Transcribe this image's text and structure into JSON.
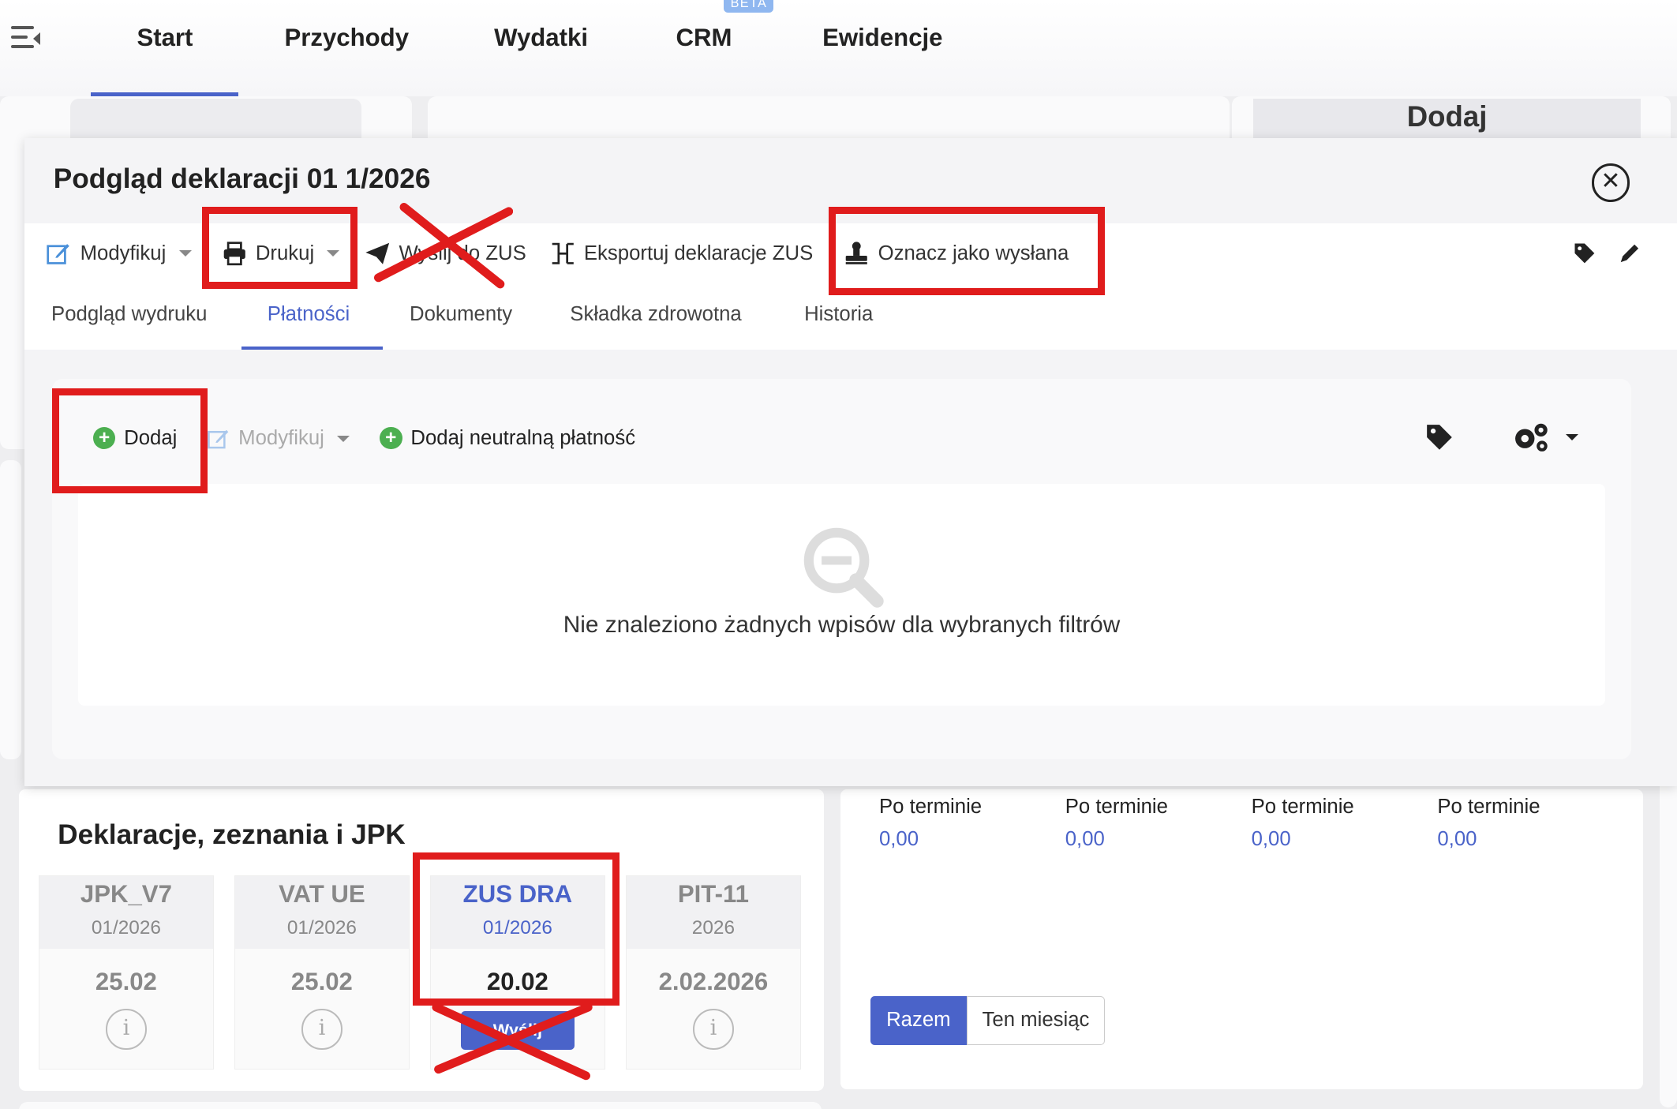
{
  "nav": {
    "items": [
      "Start",
      "Przychody",
      "Wydatki",
      "CRM",
      "Ewidencje"
    ],
    "beta_badge": "BETA"
  },
  "background": {
    "add_button": "Dodaj"
  },
  "modal": {
    "title": "Podgląd deklaracji 01 1/2026",
    "toolbar": {
      "modify": "Modyfikuj",
      "print": "Drukuj",
      "send_zus": "Wyślij do ZUS",
      "export": "Eksportuj deklaracje ZUS",
      "mark_sent": "Oznacz jako wysłana"
    },
    "tabs": [
      "Podgląd wydruku",
      "Płatności",
      "Dokumenty",
      "Składka zdrowotna",
      "Historia"
    ],
    "active_tab": "Płatności",
    "payments": {
      "add": "Dodaj",
      "modify": "Modyfikuj",
      "add_neutral": "Dodaj neutralną płatność",
      "empty_message": "Nie znaleziono żadnych wpisów dla wybranych filtrów"
    }
  },
  "declarations": {
    "title": "Deklaracje, zeznania i JPK",
    "cards": [
      {
        "name": "JPK_V7",
        "period": "01/2026",
        "date": "25.02"
      },
      {
        "name": "VAT UE",
        "period": "01/2026",
        "date": "25.02"
      },
      {
        "name": "ZUS DRA",
        "period": "01/2026",
        "date": "20.02",
        "button": "Wyślij"
      },
      {
        "name": "PIT-11",
        "period": "2026",
        "date": "2.02.2026"
      }
    ]
  },
  "summary": {
    "columns": [
      {
        "label": "Po terminie",
        "value": "0,00"
      },
      {
        "label": "Po terminie",
        "value": "0,00"
      },
      {
        "label": "Po terminie",
        "value": "0,00"
      },
      {
        "label": "Po terminie",
        "value": "0,00"
      }
    ],
    "toggle": {
      "total": "Razem",
      "month": "Ten miesiąc"
    }
  },
  "colors": {
    "accent": "#4a63c9",
    "annotation_red": "#e01c1c",
    "add_green": "#4caf50"
  }
}
